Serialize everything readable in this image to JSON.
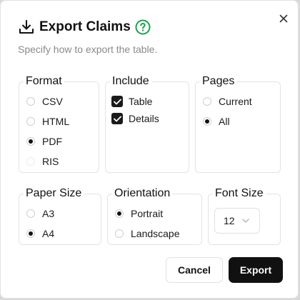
{
  "dialog": {
    "title": "Export Claims",
    "subtitle": "Specify how to export the table.",
    "accent_color": "#16a34a"
  },
  "icons": {
    "title_icon": "download-icon",
    "help_icon": "help-circle-icon",
    "close_icon": "close-icon",
    "select_icon": "chevron-down-icon"
  },
  "format": {
    "legend": "Format",
    "options": [
      {
        "label": "CSV",
        "checked": false
      },
      {
        "label": "HTML",
        "checked": false
      },
      {
        "label": "PDF",
        "checked": true
      },
      {
        "label": "RIS",
        "checked": false
      }
    ]
  },
  "include": {
    "legend": "Include",
    "options": [
      {
        "label": "Table",
        "checked": true
      },
      {
        "label": "Details",
        "checked": true
      }
    ]
  },
  "pages": {
    "legend": "Pages",
    "options": [
      {
        "label": "Current",
        "checked": false
      },
      {
        "label": "All",
        "checked": true
      }
    ]
  },
  "paper_size": {
    "legend": "Paper Size",
    "options": [
      {
        "label": "A3",
        "checked": false
      },
      {
        "label": "A4",
        "checked": true
      }
    ]
  },
  "orientation": {
    "legend": "Orientation",
    "options": [
      {
        "label": "Portrait",
        "checked": true
      },
      {
        "label": "Landscape",
        "checked": false
      }
    ]
  },
  "font_size": {
    "legend": "Font Size",
    "value": "12"
  },
  "actions": {
    "cancel_label": "Cancel",
    "export_label": "Export"
  }
}
